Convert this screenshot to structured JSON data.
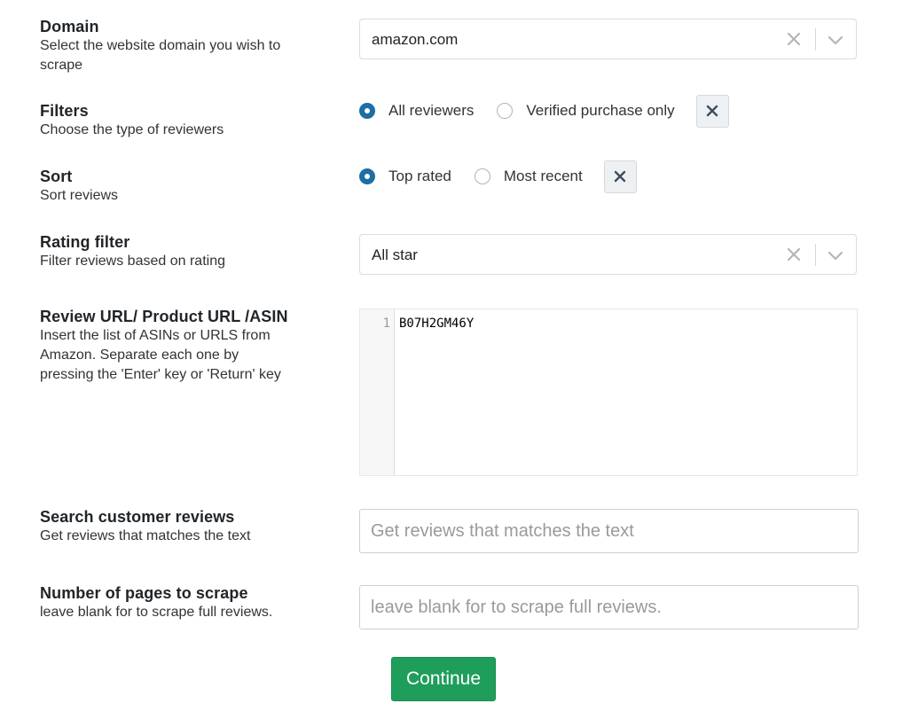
{
  "domain": {
    "title": "Domain",
    "description": "Select the website domain you wish to scrape",
    "value": "amazon.com",
    "clear_icon": "close-icon",
    "dropdown_icon": "chevron-down-icon"
  },
  "filters": {
    "title": "Filters",
    "description": "Choose the type of reviewers",
    "options": [
      {
        "label": "All reviewers",
        "checked": true
      },
      {
        "label": "Verified purchase only",
        "checked": false
      }
    ],
    "clear_icon": "close-icon"
  },
  "sort": {
    "title": "Sort",
    "description": "Sort reviews",
    "options": [
      {
        "label": "Top rated",
        "checked": true
      },
      {
        "label": "Most recent",
        "checked": false
      }
    ],
    "clear_icon": "close-icon"
  },
  "rating_filter": {
    "title": "Rating filter",
    "description": "Filter reviews based on rating",
    "value": "All star"
  },
  "review_urls": {
    "title": "Review URL/ Product URL /ASIN",
    "description": "Insert the list of ASINs or URLS from Amazon. Separate each one by pressing the 'Enter' key or 'Return' key",
    "line_number": "1",
    "content": "B07H2GM46Y"
  },
  "search_reviews": {
    "title": "Search customer reviews",
    "description": "Get reviews that matches the text",
    "placeholder": "Get reviews that matches the text",
    "value": ""
  },
  "pages": {
    "title": "Number of pages to scrape",
    "description": "leave blank for to scrape full reviews.",
    "placeholder": "leave blank for to scrape full reviews.",
    "value": ""
  },
  "continue_label": "Continue",
  "colors": {
    "accent": "#1c6ea4",
    "continue_button": "#1e9e5a"
  }
}
